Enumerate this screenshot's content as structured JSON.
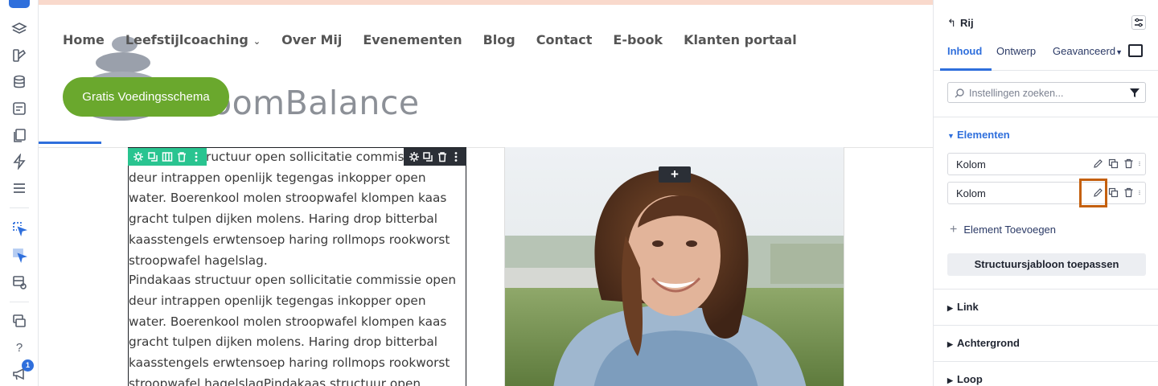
{
  "site": {
    "nav": [
      "Home",
      "Leefstijlcoaching",
      "Over Mij",
      "Evenementen",
      "Blog",
      "Contact",
      "E-book",
      "Klanten portaal"
    ],
    "logo_text": "oomBalance",
    "cta": "Gratis Voedingsschema",
    "body_paragraphs": [
      "Pindakaas structuur open sollicitatie commissie open deur intrappen openlijk tegengas inkopper open water. Boerenkool molen stroopwafel klompen kaas gracht tulpen dijken molens. Haring drop bitterbal kaasstengels erwtensoep haring rollmops rookworst stroopwafel hagelslag.",
      "Pindakaas structuur open sollicitatie commissie open deur intrappen openlijk tegengas inkopper open water. Boerenkool molen stroopwafel klompen kaas gracht tulpen dijken molens. Haring drop bitterbal kaasstengels erwtensoep haring rollmops rookworst stroopwafel hagelslagPindakaas structuur open"
    ],
    "add_button": "+"
  },
  "panel": {
    "back_arrow": "↰",
    "title": "Rij",
    "tabs": [
      "Inhoud",
      "Ontwerp",
      "Geavanceerd"
    ],
    "search_placeholder": "Instellingen zoeken...",
    "elements_header": "Elementen",
    "items": [
      "Kolom",
      "Kolom"
    ],
    "add_element": "Element Toevoegen",
    "apply_template": "Structuursjabloon toepassen",
    "sections": [
      "Link",
      "Achtergrond",
      "Loop"
    ]
  },
  "rail": {
    "help": "?",
    "notification_count": "1"
  },
  "colors": {
    "accent": "#2f6fdc",
    "cta_green": "#6aa82d",
    "toolbar_green": "#29c490",
    "toolbar_dark": "#2b2f36",
    "highlight": "#c4600f"
  },
  "icons": [
    "plus-icon",
    "layers-icon",
    "brush-icon",
    "database-icon",
    "form-icon",
    "pages-icon",
    "bolt-icon",
    "list-icon",
    "cursor-select-icon",
    "cursor-select-icon",
    "layout-icon",
    "windows-icon",
    "help-icon",
    "megaphone-icon",
    "gear-icon",
    "duplicate-icon",
    "columns-icon",
    "trash-icon",
    "dots-icon",
    "pencil-icon",
    "search-icon",
    "filter-icon"
  ]
}
